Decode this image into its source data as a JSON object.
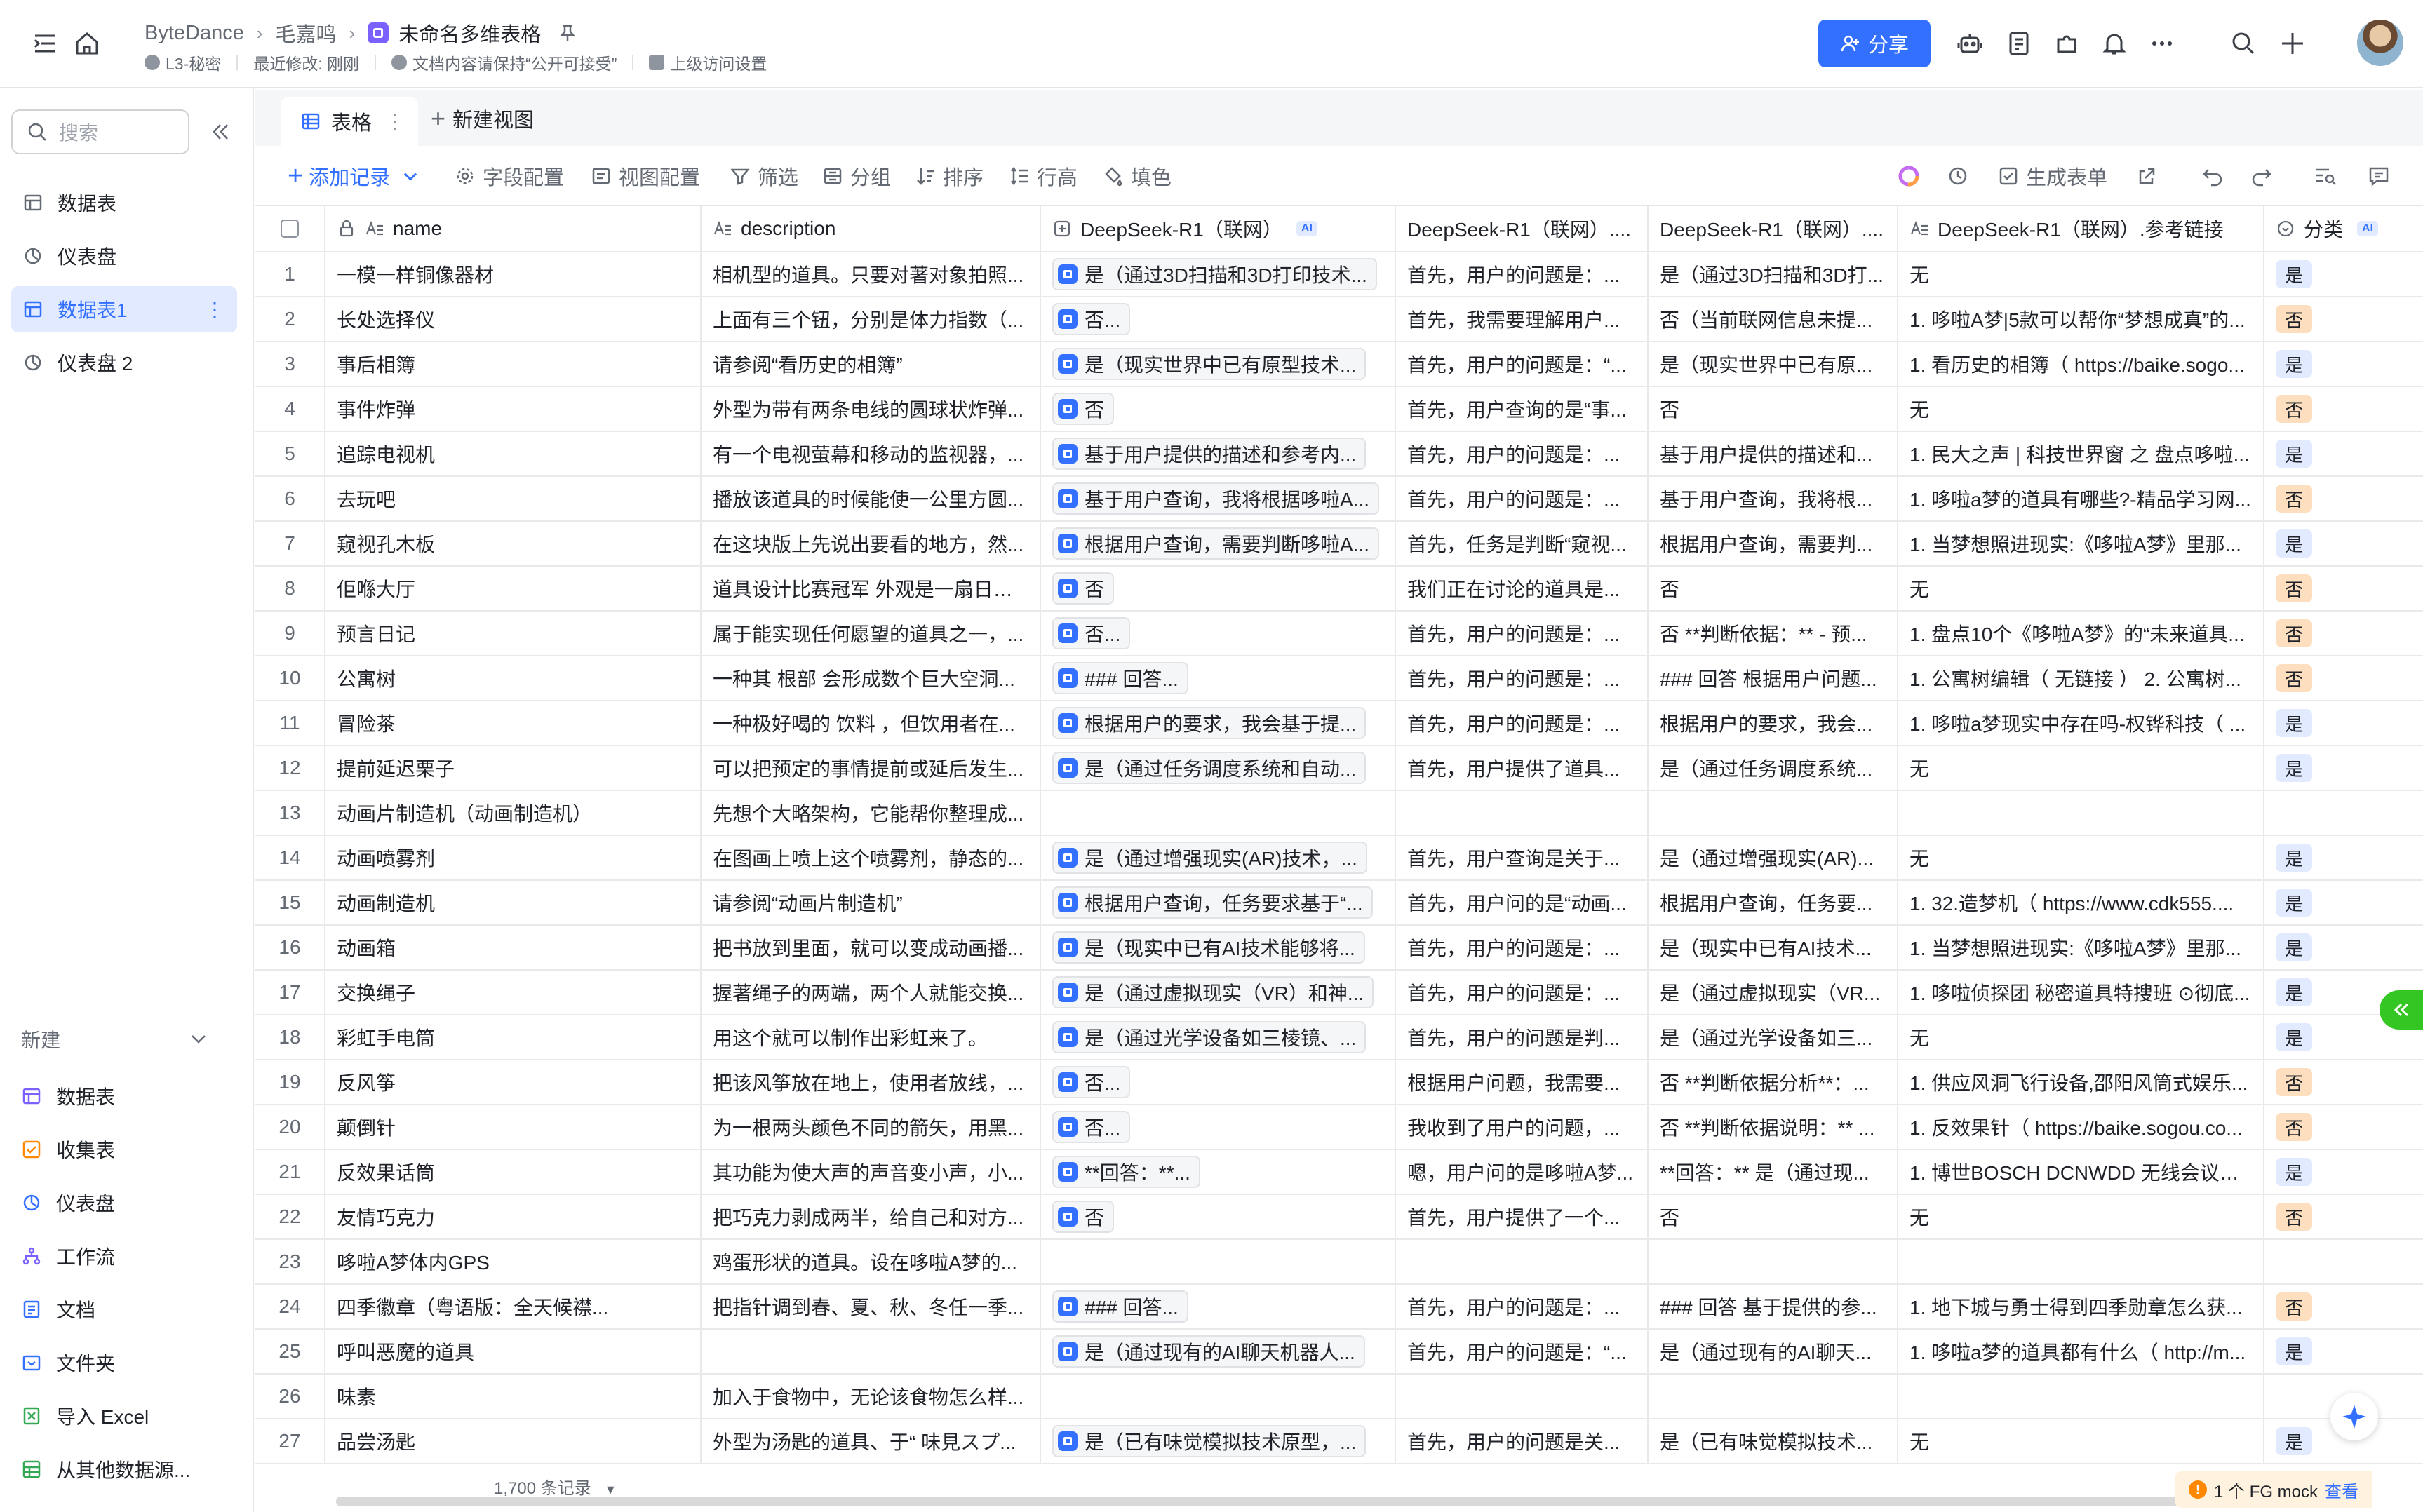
{
  "colors": {
    "accent": "#3370ff",
    "yes_tag": "#e1eaff",
    "no_tag": "#fddfbf",
    "notice": "#ff8800"
  },
  "header": {
    "breadcrumb": [
      "ByteDance",
      "毛嘉鸣",
      "未命名多维表格"
    ],
    "meta": [
      "L3-秘密",
      "最近修改: 刚刚",
      "文档内容请保持“公开可接受”",
      "上级访问设置"
    ],
    "share_label": "分享"
  },
  "sidebar": {
    "search_placeholder": "搜索",
    "items": [
      {
        "label": "数据表",
        "icon": "table-icon"
      },
      {
        "label": "仪表盘",
        "icon": "dashboard-icon"
      },
      {
        "label": "数据表1",
        "icon": "table-icon",
        "active": true
      },
      {
        "label": "仪表盘 2",
        "icon": "dashboard-icon"
      }
    ],
    "more_glyph": "⋮",
    "new_section": "新建",
    "new_items": [
      {
        "label": "数据表",
        "icon": "table-icon"
      },
      {
        "label": "收集表",
        "icon": "form-icon"
      },
      {
        "label": "仪表盘",
        "icon": "dashboard-icon"
      },
      {
        "label": "工作流",
        "icon": "workflow-icon"
      },
      {
        "label": "文档",
        "icon": "doc-icon"
      },
      {
        "label": "文件夹",
        "icon": "folder-icon"
      },
      {
        "label": "导入 Excel",
        "icon": "excel-icon"
      },
      {
        "label": "从其他数据源...",
        "icon": "datasource-icon"
      }
    ]
  },
  "views": {
    "active_tab": "表格",
    "new_view": "新建视图"
  },
  "toolbar": {
    "add_record": "添加记录",
    "field_config": "字段配置",
    "view_config": "视图配置",
    "filter": "筛选",
    "group": "分组",
    "sort": "排序",
    "row_height": "行高",
    "fill": "填色",
    "generate_form": "生成表单"
  },
  "table": {
    "columns": [
      "name",
      "description",
      "DeepSeek-R1（联网）",
      "DeepSeek-R1（联网）....",
      "DeepSeek-R1（联网）....",
      "DeepSeek-R1（联网）.参考链接",
      "分类"
    ],
    "ai_tag": "AI",
    "rows": [
      {
        "n": "1",
        "name": "一模一样铜像器材",
        "desc": "相机型的道具。只要对著对象拍照...",
        "ai": "是（通过3D扫描和3D打印技术...",
        "r1": "首先，用户的问题是：...",
        "r2": "是（通过3D扫描和3D打...",
        "link": "无",
        "cat": "是"
      },
      {
        "n": "2",
        "name": "长处选择仪",
        "desc": "上面有三个钮，分别是体力指数（...",
        "ai": "否...",
        "r1": "首先，我需要理解用户...",
        "r2": "否（当前联网信息未提...",
        "link": "1. 哆啦A梦|5款可以帮你“梦想成真”的...",
        "cat": "否"
      },
      {
        "n": "3",
        "name": "事后相簿",
        "desc": "请参阅“看历史的相簿”",
        "ai": "是（现实世界中已有原型技术...",
        "r1": "首先，用户的问题是：“...",
        "r2": "是（现实世界中已有原...",
        "link": "1. 看历史的相簿（ https://baike.sogo...",
        "cat": "是"
      },
      {
        "n": "4",
        "name": "事件炸弹",
        "desc": "外型为带有两条电线的圆球状炸弹...",
        "ai": "否",
        "r1": "首先，用户查询的是“事...",
        "r2": "否",
        "link": "无",
        "cat": "否"
      },
      {
        "n": "5",
        "name": "追踪电视机",
        "desc": "有一个电视萤幕和移动的监视器，...",
        "ai": "基于用户提供的描述和参考内...",
        "r1": "首先，用户的问题是：...",
        "r2": "基于用户提供的描述和...",
        "link": "1. 民大之声 | 科技世界窗 之 盘点哆啦...",
        "cat": "是"
      },
      {
        "n": "6",
        "name": "去玩吧",
        "desc": "播放该道具的时候能使一公里方圆...",
        "ai": "基于用户查询，我将根据哆啦A...",
        "r1": "首先，用户的问题是：...",
        "r2": "基于用户查询，我将根...",
        "link": "1. 哆啦a梦的道具有哪些?-精品学习网...",
        "cat": "否"
      },
      {
        "n": "7",
        "name": "窥视孔木板",
        "desc": "在这块版上先说出要看的地方，然...",
        "ai": "根据用户查询，需要判断哆啦A...",
        "r1": "首先，任务是判断“窥视...",
        "r2": "根据用户查询，需要判...",
        "link": "1. 当梦想照进现实:《哆啦A梦》里那...",
        "cat": "是"
      },
      {
        "n": "8",
        "name": "佢喺大厅",
        "desc": "道具设计比赛冠军 外观是一扇日式...",
        "ai": "否",
        "r1": "我们正在讨论的道具是...",
        "r2": "否",
        "link": "无",
        "cat": "否"
      },
      {
        "n": "9",
        "name": "预言日记",
        "desc": "属于能实现任何愿望的道具之一，...",
        "ai": "否...",
        "r1": "首先，用户的问题是：...",
        "r2": "否 **判断依据：** - 预...",
        "link": "1. 盘点10个《哆啦A梦》的“未来道具...",
        "cat": "否"
      },
      {
        "n": "10",
        "name": "公寓树",
        "desc": "一种其 根部 会形成数个巨大空洞...",
        "ai": "### 回答...",
        "r1": "首先，用户的问题是：...",
        "r2": "### 回答 根据用户问题...",
        "link": "1. 公寓树编辑（ 无链接 ） 2. 公寓树...",
        "cat": "否"
      },
      {
        "n": "11",
        "name": "冒险茶",
        "desc": "一种极好喝的 饮料 ，但饮用者在...",
        "ai": "根据用户的要求，我会基于提...",
        "r1": "首先，用户的问题是：...",
        "r2": "根据用户的要求，我会...",
        "link": "1. 哆啦a梦现实中存在吗-权铧科技（ ...",
        "cat": "是"
      },
      {
        "n": "12",
        "name": "提前延迟栗子",
        "desc": "可以把预定的事情提前或延后发生...",
        "ai": "是（通过任务调度系统和自动...",
        "r1": "首先，用户提供了道具...",
        "r2": "是（通过任务调度系统...",
        "link": "无",
        "cat": "是"
      },
      {
        "n": "13",
        "name": "动画片制造机（动画制造机）",
        "desc": "先想个大略架构，它能帮你整理成...",
        "ai": "",
        "r1": "",
        "r2": "",
        "link": "",
        "cat": ""
      },
      {
        "n": "14",
        "name": "动画喷雾剂",
        "desc": "在图画上喷上这个喷雾剂，静态的...",
        "ai": "是（通过增强现实(AR)技术，...",
        "r1": "首先，用户查询是关于...",
        "r2": "是（通过增强现实(AR)...",
        "link": "无",
        "cat": "是"
      },
      {
        "n": "15",
        "name": "动画制造机",
        "desc": "请参阅“动画片制造机”",
        "ai": "根据用户查询，任务要求基于“...",
        "r1": "首先，用户问的是“动画...",
        "r2": "根据用户查询，任务要...",
        "link": "1. 32.造梦机（ https://www.cdk555....",
        "cat": "是"
      },
      {
        "n": "16",
        "name": "动画箱",
        "desc": "把书放到里面，就可以变成动画播...",
        "ai": "是（现实中已有AI技术能够将...",
        "r1": "首先，用户的问题是：...",
        "r2": "是（现实中已有AI技术...",
        "link": "1. 当梦想照进现实:《哆啦A梦》里那...",
        "cat": "是"
      },
      {
        "n": "17",
        "name": "交换绳子",
        "desc": "握著绳子的两端，两个人就能交换...",
        "ai": "是（通过虚拟现实（VR）和神...",
        "r1": "首先，用户的问题是：...",
        "r2": "是（通过虚拟现实（VR...",
        "link": "1. 哆啦侦探团 秘密道具特搜班 ⊙彻底...",
        "cat": "是"
      },
      {
        "n": "18",
        "name": "彩虹手电筒",
        "desc": "用这个就可以制作出彩虹来了。",
        "ai": "是（通过光学设备如三棱镜、...",
        "r1": "首先，用户的问题是判...",
        "r2": "是（通过光学设备如三...",
        "link": "无",
        "cat": "是"
      },
      {
        "n": "19",
        "name": "反风筝",
        "desc": "把该风筝放在地上，使用者放线，...",
        "ai": "否...",
        "r1": "根据用户问题，我需要...",
        "r2": "否 **判断依据分析**：...",
        "link": "1. 供应风洞飞行设备,邵阳风筒式娱乐...",
        "cat": "否"
      },
      {
        "n": "20",
        "name": "颠倒针",
        "desc": "为一根两头颜色不同的箭矢，用黑...",
        "ai": "否...",
        "r1": "我收到了用户的问题，...",
        "r2": "否 **判断依据说明：** ...",
        "link": "1. 反效果针（ https://baike.sogou.co...",
        "cat": "否"
      },
      {
        "n": "21",
        "name": "反效果话筒",
        "desc": "其功能为使大声的声音变小声，小...",
        "ai": "**回答：**...",
        "r1": "嗯，用户问的是哆啦A梦...",
        "r2": "**回答：** 是（通过现...",
        "link": "1. 博世BOSCH DCNWDD 无线会议代...",
        "cat": "是"
      },
      {
        "n": "22",
        "name": "友情巧克力",
        "desc": "把巧克力剥成两半，给自己和对方...",
        "ai": "否",
        "r1": "首先，用户提供了一个...",
        "r2": "否",
        "link": "无",
        "cat": "否"
      },
      {
        "n": "23",
        "name": "哆啦A梦体内GPS",
        "desc": "鸡蛋形状的道具。设在哆啦A梦的...",
        "ai": "",
        "r1": "",
        "r2": "",
        "link": "",
        "cat": ""
      },
      {
        "n": "24",
        "name": "四季徽章（粤语版：全天候襟...",
        "desc": "把指针调到春、夏、秋、冬任一季...",
        "ai": "### 回答...",
        "r1": "首先，用户的问题是：...",
        "r2": "### 回答 基于提供的参...",
        "link": "1. 地下城与勇士得到四季勋章怎么获...",
        "cat": "否"
      },
      {
        "n": "25",
        "name": "呼叫恶魔的道具",
        "desc": "",
        "ai": "是（通过现有的AI聊天机器人...",
        "r1": "首先，用户的问题是：“...",
        "r2": "是（通过现有的AI聊天...",
        "link": "1. 哆啦a梦的道具都有什么（ http://m...",
        "cat": "是"
      },
      {
        "n": "26",
        "name": "味素",
        "desc": "加入于食物中，无论该食物怎么样...",
        "ai": "",
        "r1": "",
        "r2": "",
        "link": "",
        "cat": ""
      },
      {
        "n": "27",
        "name": "品尝汤匙",
        "desc": "外型为汤匙的道具、于“ 味見スプ...",
        "ai": "是（已有味觉模拟技术原型，...",
        "r1": "首先，用户的问题是关...",
        "r2": "是（已有味觉模拟技术...",
        "link": "无",
        "cat": "是"
      }
    ]
  },
  "footer": {
    "record_count": "1,700 条记录",
    "count_caret": "▼",
    "notice": "1 个 FG mock",
    "notice_link": "查看"
  }
}
